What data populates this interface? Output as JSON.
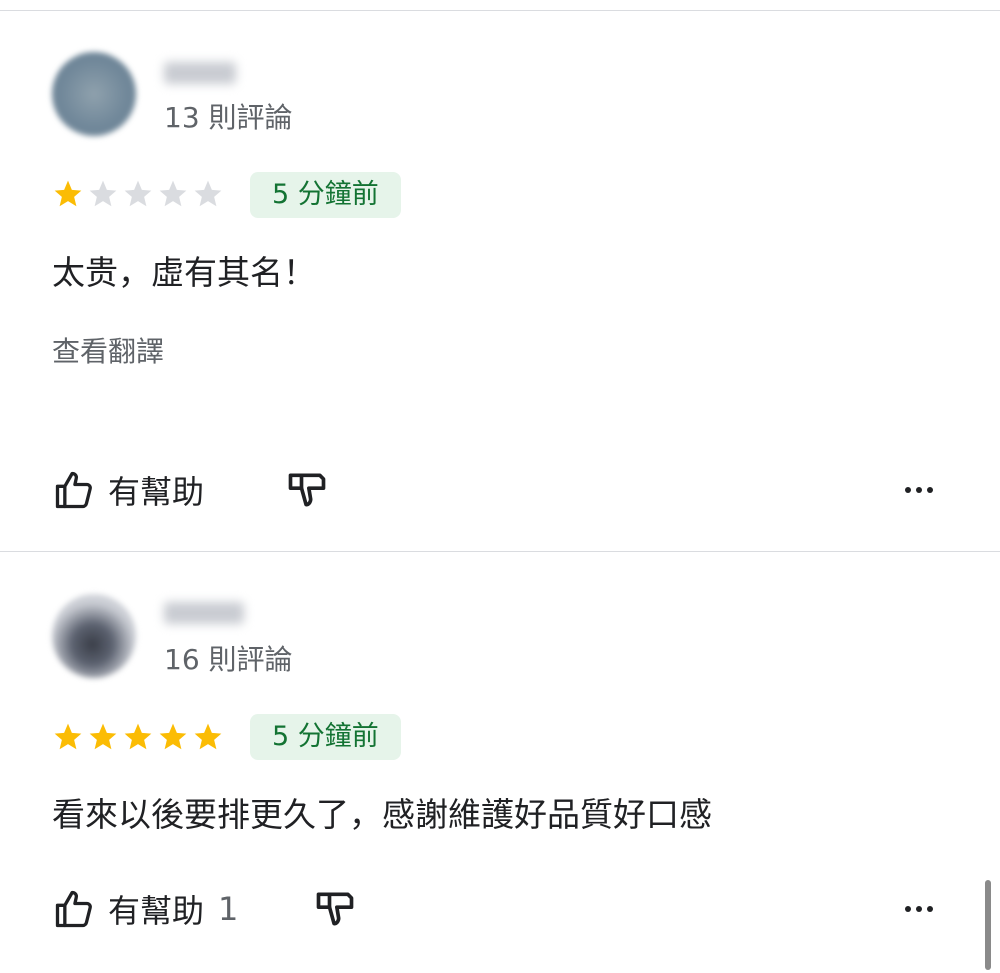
{
  "reviews": [
    {
      "review_count": "13 則評論",
      "rating": 1,
      "max_rating": 5,
      "time": "5 分鐘前",
      "text": "太贵，虛有其名！",
      "translate_link": "查看翻譯",
      "helpful_label": "有幫助",
      "helpful_count": ""
    },
    {
      "review_count": "16 則評論",
      "rating": 5,
      "max_rating": 5,
      "time": "5 分鐘前",
      "text": "看來以後要排更久了，感謝維護好品質好口感",
      "helpful_label": "有幫助",
      "helpful_count": "1"
    }
  ],
  "icons": {
    "like": "thumb-up-icon",
    "dislike": "thumb-down-icon",
    "more": "more-horizontal-icon",
    "star": "star-icon"
  },
  "colors": {
    "star_on": "#fbbc04",
    "star_off": "#dadce0",
    "badge_bg": "#e6f4ea",
    "badge_text": "#137333"
  }
}
